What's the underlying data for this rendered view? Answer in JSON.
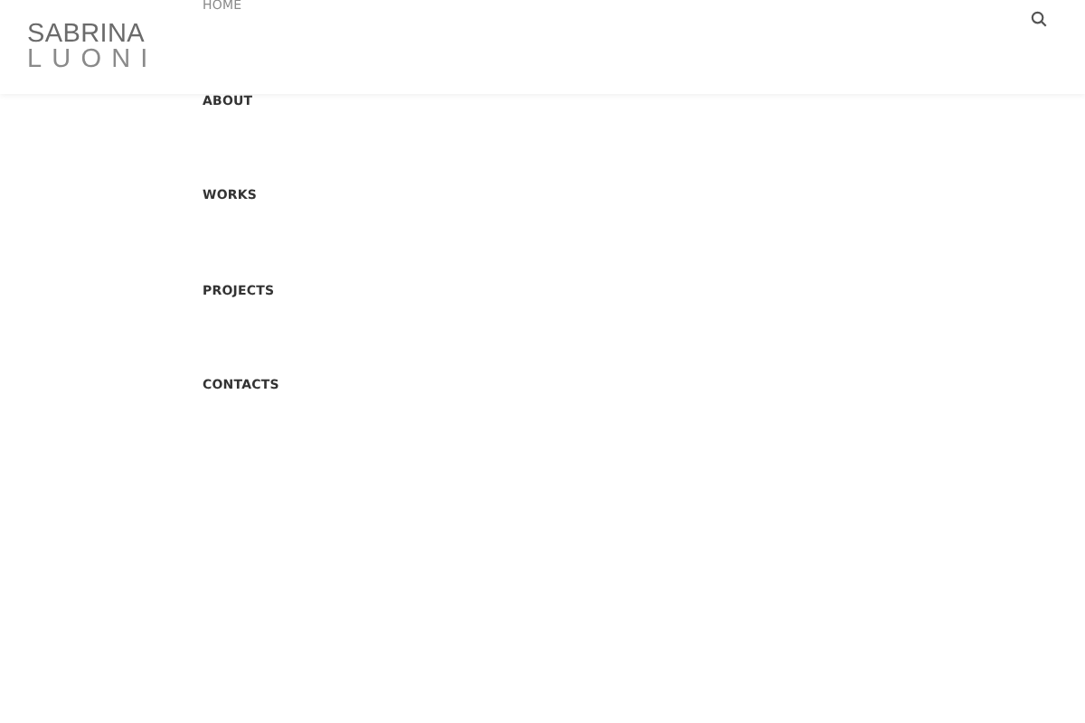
{
  "logo": {
    "line_1": "SABRINA",
    "line_2": "LUONI"
  },
  "nav": [
    {
      "label": "HOME",
      "selected": true
    },
    {
      "label": "ABOUT",
      "selected": false
    },
    {
      "label": "WORKS",
      "selected": false
    },
    {
      "label": "PROJECTS",
      "selected": false
    },
    {
      "label": "CONTACTS",
      "selected": false
    }
  ]
}
